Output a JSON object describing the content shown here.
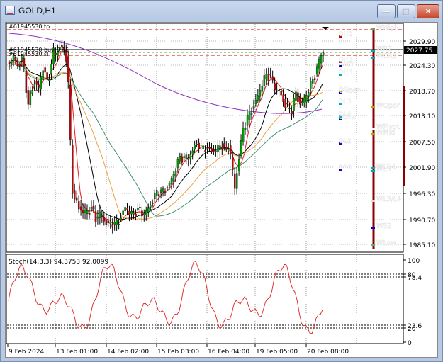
{
  "window": {
    "title": "GOLD,H1",
    "minimize_glyph": "—",
    "maximize_glyph": "□",
    "close_glyph": "✕"
  },
  "price_chart": {
    "price_ticks": [
      "2029.90",
      "2024.30",
      "2018.70",
      "2013.10",
      "2007.50",
      "2001.90",
      "1996.30",
      "1990.70",
      "1985.10"
    ],
    "current_price": "2027.75",
    "order_labels": [
      "#61945530 tp",
      "#61945530 buy 0.85",
      "#61945530 sl"
    ],
    "pivot_labels": [
      "DH2",
      "DH1",
      "High",
      "DH3",
      "DOpen",
      "Close",
      "DL3",
      "DL4",
      "DLow",
      "DL2",
      "DS3"
    ],
    "weekly_labels": [
      "WHigh",
      "WR2",
      "WCR1",
      "WOpen",
      "WPivot",
      "WMid",
      "WCS1",
      "WL3",
      "WL3/L4",
      "WS2",
      "WLow"
    ]
  },
  "stoch": {
    "label": "Stoch(14,3,3) 94.3753 92.0099",
    "ticks": [
      "100",
      "80",
      "78.4",
      "23.6",
      "20",
      "0"
    ]
  },
  "time_axis": {
    "labels": [
      "9 Feb 2024",
      "13 Feb 01:00",
      "14 Feb 02:00",
      "15 Feb 03:00",
      "16 Feb 04:00",
      "19 Feb 05:00",
      "20 Feb 08:00"
    ]
  },
  "colors": {
    "up_candle": "#00a000",
    "down_candle": "#cc0000",
    "ma_fast": "#e02020",
    "ma_black": "#000000",
    "ma_orange": "#f0a040",
    "ma_green": "#409070",
    "ma_purple": "#9030c0"
  }
}
